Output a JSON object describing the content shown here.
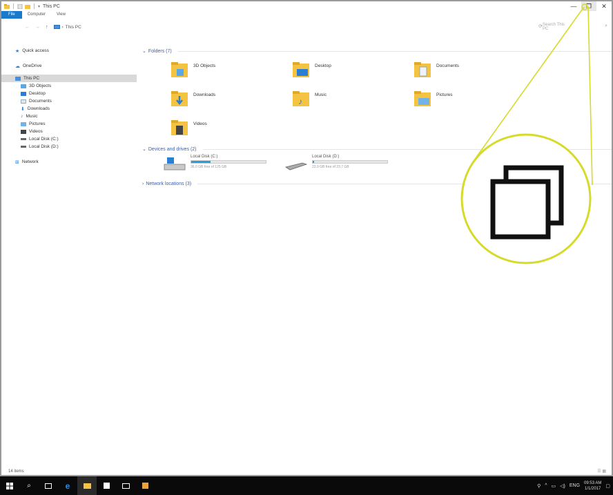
{
  "window": {
    "title": "This PC",
    "controls": {
      "minimize": "—",
      "restore": "❐",
      "close": "✕"
    }
  },
  "ribbon": {
    "tabs": [
      "File",
      "Computer",
      "View"
    ]
  },
  "address": {
    "nav_back": "←",
    "nav_forward": "→",
    "nav_up": "↑",
    "path": "This PC",
    "search_placeholder": "Search This PC"
  },
  "sidebar": {
    "items": [
      {
        "label": "Quick access",
        "icon": "star-icon"
      },
      {
        "label": "OneDrive",
        "icon": "cloud-icon"
      },
      {
        "label": "This PC",
        "icon": "computer-icon"
      },
      {
        "label": "3D Objects",
        "icon": "cube-icon"
      },
      {
        "label": "Desktop",
        "icon": "desktop-icon"
      },
      {
        "label": "Documents",
        "icon": "document-icon"
      },
      {
        "label": "Downloads",
        "icon": "download-icon"
      },
      {
        "label": "Music",
        "icon": "music-icon"
      },
      {
        "label": "Pictures",
        "icon": "picture-icon"
      },
      {
        "label": "Videos",
        "icon": "video-icon"
      },
      {
        "label": "Local Disk (C:)",
        "icon": "drive-icon"
      },
      {
        "label": "Local Disk (D:)",
        "icon": "drive-icon"
      },
      {
        "label": "Network",
        "icon": "network-icon"
      }
    ]
  },
  "main": {
    "folders_header": "Folders (7)",
    "folders": [
      {
        "name": "3D Objects"
      },
      {
        "name": "Desktop"
      },
      {
        "name": "Documents"
      },
      {
        "name": "Downloads"
      },
      {
        "name": "Music"
      },
      {
        "name": "Pictures"
      },
      {
        "name": "Videos"
      }
    ],
    "devices_header": "Devices and drives (2)",
    "drives": [
      {
        "name": "Local Disk (C:)",
        "free": "36.0 GB free of 125 GB",
        "used_fraction": 0.26
      },
      {
        "name": "Local Disk (D:)",
        "free": "23.9 GB free of 23.7 GB",
        "used_fraction": 0.02
      }
    ],
    "network_header": "Network locations (3)"
  },
  "status": {
    "count": "14 items"
  },
  "taskbar": {
    "tray_lang": "ENG",
    "time": "09:53 AM",
    "date": "1/1/2017"
  },
  "colors": {
    "accent": "#1979ca",
    "folder": "#f5c342",
    "callout": "#d6db2a"
  }
}
